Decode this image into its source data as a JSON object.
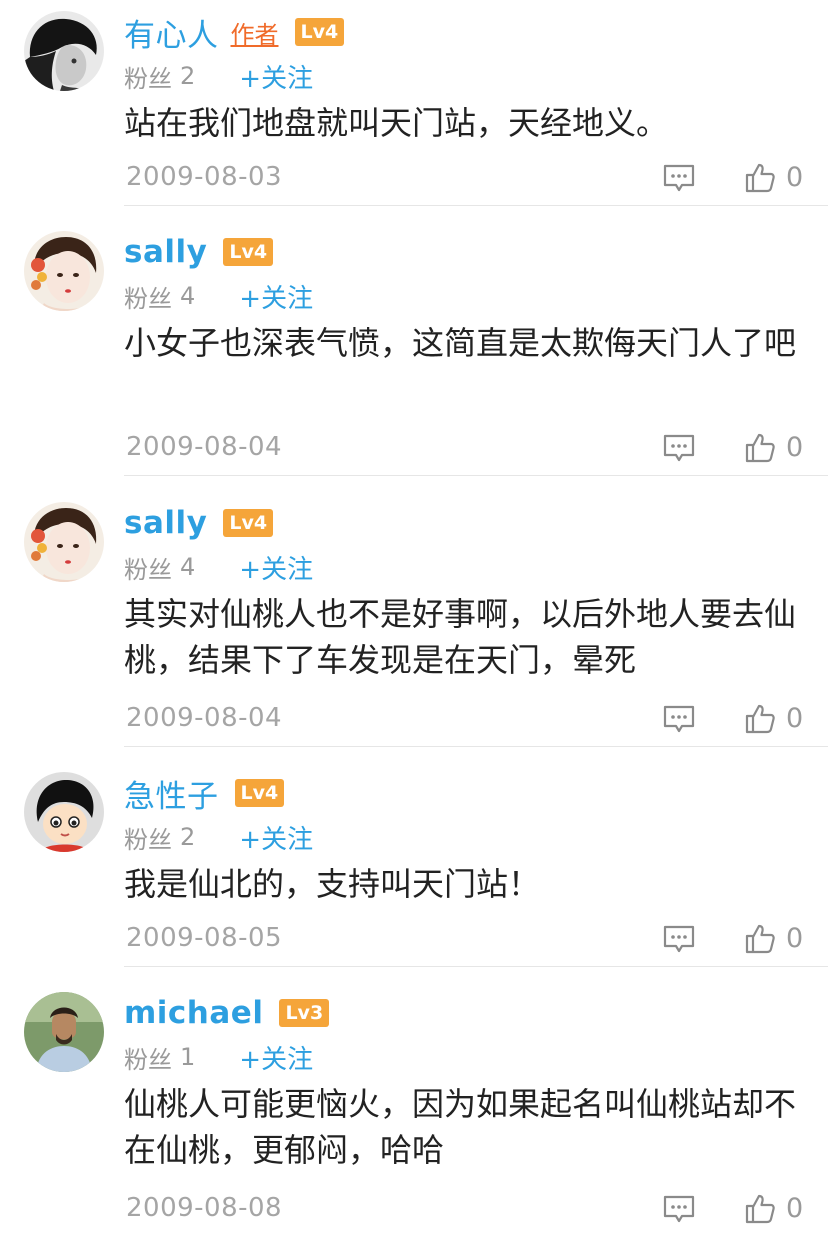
{
  "comments": [
    {
      "username": "有心人",
      "author_tag": "作者",
      "level": "Lv4",
      "fans_label": "粉丝",
      "fans_count": "2",
      "follow_label": "+关注",
      "text": "站在我们地盘就叫天门站，天经地义。",
      "date": "2009-08-03",
      "likes": "0",
      "avatar_icon": "grayscale-portrait-avatar"
    },
    {
      "username": "sally",
      "level": "Lv4",
      "fans_label": "粉丝",
      "fans_count": "4",
      "follow_label": "+关注",
      "text": "小女子也深表气愤，这简直是太欺侮天门人了吧",
      "date": "2009-08-04",
      "likes": "0",
      "avatar_icon": "illustrated-girl-avatar"
    },
    {
      "username": "sally",
      "level": "Lv4",
      "fans_label": "粉丝",
      "fans_count": "4",
      "follow_label": "+关注",
      "text": "其实对仙桃人也不是好事啊，以后外地人要去仙桃，结果下了车发现是在天门，晕死",
      "date": "2009-08-04",
      "likes": "0",
      "avatar_icon": "illustrated-girl-avatar"
    },
    {
      "username": "急性子",
      "level": "Lv4",
      "fans_label": "粉丝",
      "fans_count": "2",
      "follow_label": "+关注",
      "text": "我是仙北的，支持叫天门站！",
      "date": "2009-08-05",
      "likes": "0",
      "avatar_icon": "cartoon-boy-avatar"
    },
    {
      "username": "michael",
      "level": "Lv3",
      "fans_label": "粉丝",
      "fans_count": "1",
      "follow_label": "+关注",
      "text": "仙桃人可能更恼火，因为如果起名叫仙桃站却不在仙桃，更郁闷，哈哈",
      "date": "2009-08-08",
      "likes": "0",
      "avatar_icon": "outdoor-man-avatar"
    }
  ],
  "colors": {
    "username": "#2d9fe0",
    "author_tag": "#f06b2a",
    "level_badge": "#f5a53a",
    "meta_gray": "#9a9a9a",
    "text": "#222222"
  }
}
